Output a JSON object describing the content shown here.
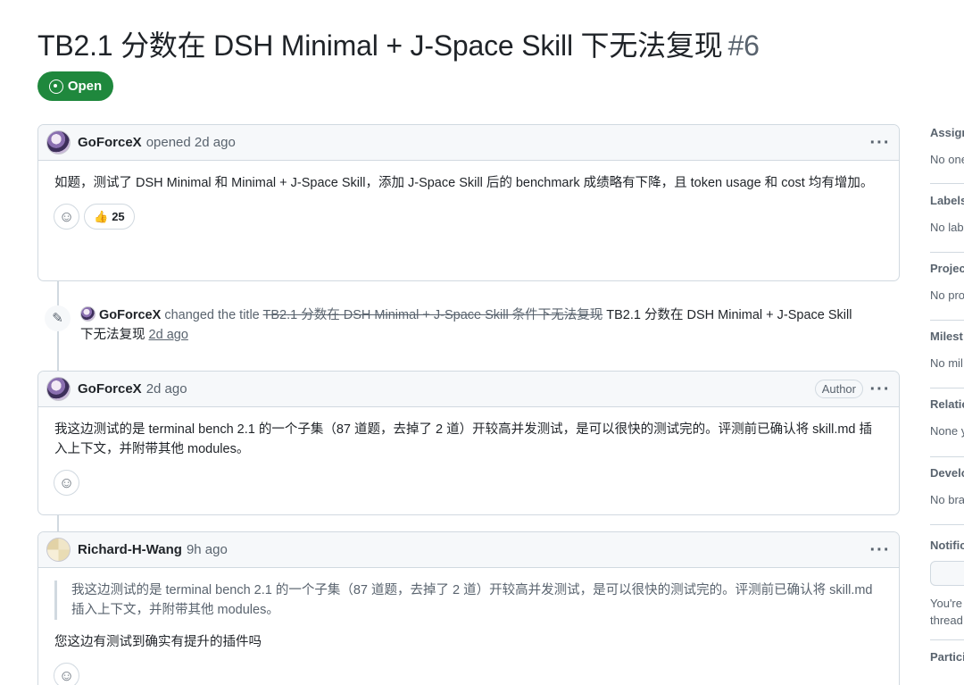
{
  "issue": {
    "title": "TB2.1 分数在 DSH Minimal + J-Space Skill 下无法复现",
    "number": "#6",
    "state": "Open"
  },
  "comments": [
    {
      "author": "GoForceX",
      "meta": "opened 2d ago",
      "body": "如题，测试了 DSH Minimal 和 Minimal + J-Space Skill，添加 J-Space Skill 后的 benchmark 成绩略有下降，且 token usage 和 cost 均有增加。",
      "reaction_emoji": "👍",
      "reaction_count": "25"
    },
    {
      "author": "GoForceX",
      "meta": "2d ago",
      "badge": "Author",
      "body": "我这边测试的是 terminal bench 2.1 的一个子集（87 道题，去掉了 2 道）开较高并发测试，是可以很快的测试完的。评测前已确认将 skill.md 插入上下文，并附带其他 modules。"
    },
    {
      "author": "Richard-H-Wang",
      "meta": "9h ago",
      "quote": "我这边测试的是 terminal bench 2.1 的一个子集（87 道题，去掉了 2 道）开较高并发测试，是可以很快的测试完的。评测前已确认将 skill.md 插入上下文，并附带其他 modules。",
      "body": "您这边有测试到确实有提升的插件吗"
    }
  ],
  "rename_event": {
    "actor": "GoForceX",
    "action": "changed the title",
    "old_title": "TB2.1 分数在 DSH Minimal + J-Space Skill 条件下无法复现",
    "new_title": "TB2.1 分数在 DSH Minimal + J-Space Skill 下无法复现",
    "time": "2d ago"
  },
  "sidebar": {
    "assignees": {
      "label": "Assign",
      "value": "No one"
    },
    "labels": {
      "label": "Labels",
      "value": "No lab"
    },
    "projects": {
      "label": "Projec",
      "value": "No pro"
    },
    "milestone": {
      "label": "Milest",
      "value": "No mil"
    },
    "relationships": {
      "label": "Relatio",
      "value": "None y"
    },
    "development": {
      "label": "Develo",
      "value": "No bra"
    },
    "notifications": {
      "label": "Notific",
      "line1": "You're",
      "line2": "thread"
    },
    "participants": {
      "label": "Partici"
    }
  },
  "colors": {
    "open_green": "#1f883d",
    "muted_text": "#59636e",
    "border": "#d1d9e0"
  }
}
